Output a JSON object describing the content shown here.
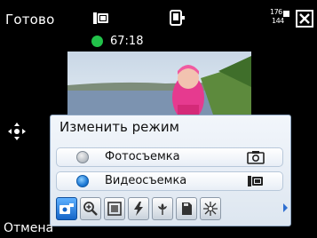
{
  "topbar": {
    "done_label": "Готово",
    "resolution_badge_top": "176",
    "resolution_badge_bottom": "144"
  },
  "recording": {
    "time": "67:18",
    "indicator_color": "#22c24a"
  },
  "menu": {
    "title": "Изменить режим",
    "options": [
      {
        "label": "Фотосъемка",
        "selected": false,
        "icon": "photo-camera-icon"
      },
      {
        "label": "Видеосъемка",
        "selected": true,
        "icon": "video-camera-icon"
      }
    ],
    "toolbar": [
      {
        "icon": "camera-mode-icon",
        "selected": true
      },
      {
        "icon": "zoom-icon",
        "selected": false
      },
      {
        "icon": "frame-icon",
        "selected": false
      },
      {
        "icon": "flash-icon",
        "selected": false
      },
      {
        "icon": "macro-flower-icon",
        "selected": false
      },
      {
        "icon": "storage-card-icon",
        "selected": false
      },
      {
        "icon": "white-balance-icon",
        "selected": false
      }
    ]
  },
  "bottombar": {
    "cancel_label": "Отмена"
  },
  "colors": {
    "accent": "#1e7ad6",
    "panel_border": "#8ea6c2"
  }
}
